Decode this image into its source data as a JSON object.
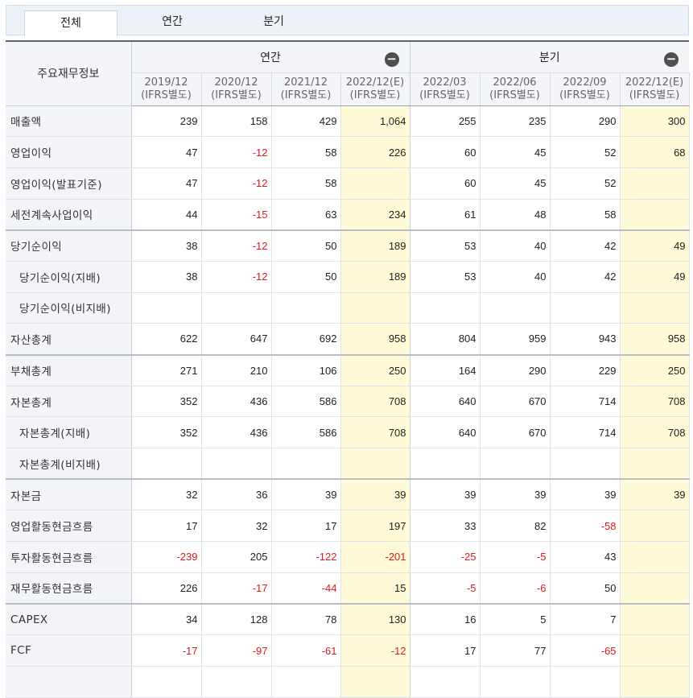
{
  "tabs": [
    {
      "label": "전체",
      "active": true
    },
    {
      "label": "연간",
      "active": false
    },
    {
      "label": "분기",
      "active": false
    }
  ],
  "corner_label": "주요재무정보",
  "groups": [
    {
      "label": "연간",
      "toggle": "−"
    },
    {
      "label": "분기",
      "toggle": "−"
    }
  ],
  "columns": [
    {
      "period": "2019/12",
      "basis": "(IFRS별도)"
    },
    {
      "period": "2020/12",
      "basis": "(IFRS별도)"
    },
    {
      "period": "2021/12",
      "basis": "(IFRS별도)"
    },
    {
      "period": "2022/12(E)",
      "basis": "(IFRS별도)"
    },
    {
      "period": "2022/03",
      "basis": "(IFRS별도)"
    },
    {
      "period": "2022/06",
      "basis": "(IFRS별도)"
    },
    {
      "period": "2022/09",
      "basis": "(IFRS별도)"
    },
    {
      "period": "2022/12(E)",
      "basis": "(IFRS별도)"
    }
  ],
  "rows": [
    {
      "label": "매출액",
      "values": [
        "239",
        "158",
        "429",
        "1,064",
        "255",
        "235",
        "290",
        "300"
      ]
    },
    {
      "label": "영업이익",
      "values": [
        "47",
        "-12",
        "58",
        "226",
        "60",
        "45",
        "52",
        "68"
      ]
    },
    {
      "label": "영업이익(발표기준)",
      "values": [
        "47",
        "-12",
        "58",
        "",
        "60",
        "45",
        "52",
        ""
      ]
    },
    {
      "label": "세전계속사업이익",
      "values": [
        "44",
        "-15",
        "63",
        "234",
        "61",
        "48",
        "58",
        ""
      ]
    },
    {
      "label": "당기순이익",
      "group_start": true,
      "values": [
        "38",
        "-12",
        "50",
        "189",
        "53",
        "40",
        "42",
        "49"
      ]
    },
    {
      "label": "당기순이익(지배)",
      "indent": true,
      "values": [
        "38",
        "-12",
        "50",
        "189",
        "53",
        "40",
        "42",
        "49"
      ]
    },
    {
      "label": "당기순이익(비지배)",
      "indent": true,
      "values": [
        "",
        "",
        "",
        "",
        "",
        "",
        "",
        ""
      ]
    },
    {
      "label": "자산총계",
      "values": [
        "622",
        "647",
        "692",
        "958",
        "804",
        "959",
        "943",
        "958"
      ]
    },
    {
      "label": "부채총계",
      "group_start": true,
      "values": [
        "271",
        "210",
        "106",
        "250",
        "164",
        "290",
        "229",
        "250"
      ]
    },
    {
      "label": "자본총계",
      "values": [
        "352",
        "436",
        "586",
        "708",
        "640",
        "670",
        "714",
        "708"
      ]
    },
    {
      "label": "자본총계(지배)",
      "indent": true,
      "values": [
        "352",
        "436",
        "586",
        "708",
        "640",
        "670",
        "714",
        "708"
      ]
    },
    {
      "label": "자본총계(비지배)",
      "indent": true,
      "values": [
        "",
        "",
        "",
        "",
        "",
        "",
        "",
        ""
      ]
    },
    {
      "label": "자본금",
      "group_start": true,
      "values": [
        "32",
        "36",
        "39",
        "39",
        "39",
        "39",
        "39",
        "39"
      ]
    },
    {
      "label": "영업활동현금흐름",
      "values": [
        "17",
        "32",
        "17",
        "197",
        "33",
        "82",
        "-58",
        ""
      ]
    },
    {
      "label": "투자활동현금흐름",
      "values": [
        "-239",
        "205",
        "-122",
        "-201",
        "-25",
        "-5",
        "43",
        ""
      ]
    },
    {
      "label": "재무활동현금흐름",
      "values": [
        "226",
        "-17",
        "-44",
        "15",
        "-5",
        "-6",
        "50",
        ""
      ]
    },
    {
      "label": "CAPEX",
      "group_start": true,
      "values": [
        "34",
        "128",
        "78",
        "130",
        "16",
        "5",
        "7",
        ""
      ]
    },
    {
      "label": "FCF",
      "values": [
        "-17",
        "-97",
        "-61",
        "-12",
        "17",
        "77",
        "-65",
        ""
      ]
    },
    {
      "label": "",
      "values": [
        "",
        "",
        "",
        "",
        "",
        "",
        "",
        ""
      ]
    }
  ],
  "colors": {
    "estimate_bg": "#fffad8",
    "negative": "#d81b1b",
    "label_bg": "#f4f5f8"
  }
}
